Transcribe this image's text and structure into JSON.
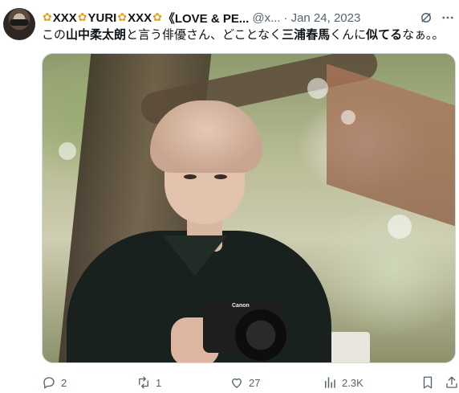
{
  "header": {
    "display_name_parts": [
      "XXX",
      "YURI",
      "XXX",
      "《LOVE & PE..."
    ],
    "handle": "@x...",
    "separator": "·",
    "date": "Jan 24, 2023"
  },
  "tweet": {
    "segments": [
      {
        "text": "この",
        "bold": false
      },
      {
        "text": "山中柔太朗",
        "bold": true
      },
      {
        "text": "と言う俳優さん、どことなく",
        "bold": false
      },
      {
        "text": "三浦春馬",
        "bold": true
      },
      {
        "text": "くんに",
        "bold": false
      },
      {
        "text": "似てる",
        "bold": true
      },
      {
        "text": "なぁ。。",
        "bold": false
      }
    ]
  },
  "media": {
    "camera_brand": "Canon"
  },
  "actions": {
    "replies": "2",
    "reposts": "1",
    "likes": "27",
    "views": "2.3K"
  },
  "icons": {
    "reply": "reply-icon",
    "repost": "repost-icon",
    "like": "heart-icon",
    "views": "views-chart-icon",
    "bookmark": "bookmark-icon",
    "share": "share-icon",
    "grok": "grok-icon",
    "more": "more-icon"
  },
  "colors": {
    "secondary_text": "#536471",
    "border": "#cfd9de"
  }
}
